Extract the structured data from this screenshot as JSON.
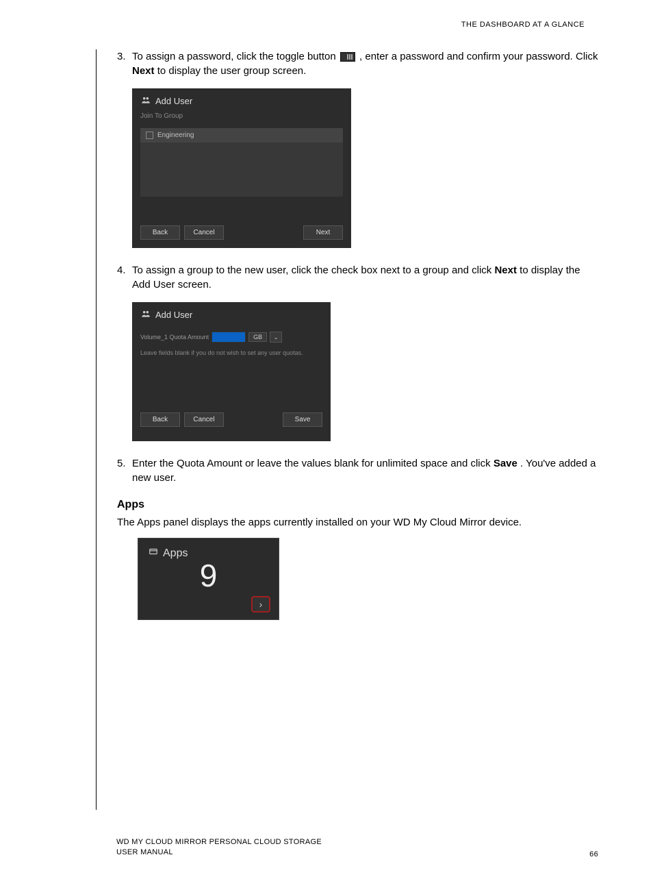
{
  "header": "THE DASHBOARD AT A GLANCE",
  "steps": {
    "s3": {
      "num": "3.",
      "pre": "To assign a password, click the toggle button ",
      "post": ", enter a password and confirm your password. Click ",
      "bold": "Next",
      "tail": " to display the user group screen."
    },
    "s4": {
      "num": "4.",
      "pre": "To assign a group to the new user, click the check box next to a group and click ",
      "bold": "Next",
      "tail": " to display the Add User screen."
    },
    "s5": {
      "num": "5.",
      "pre": "Enter the Quota Amount or leave the values blank for unlimited space and click ",
      "bold": "Save",
      "tail": ". You've added a new user."
    }
  },
  "dialog1": {
    "title": "Add User",
    "subtitle": "Join To Group",
    "group": "Engineering",
    "back": "Back",
    "cancel": "Cancel",
    "next": "Next"
  },
  "dialog2": {
    "title": "Add User",
    "quota_label": "Volume_1 Quota Amount",
    "unit": "GB",
    "hint": "Leave fields blank if you do not wish to set any user quotas.",
    "back": "Back",
    "cancel": "Cancel",
    "save": "Save"
  },
  "apps_section": {
    "heading": "Apps",
    "body": "The Apps panel displays the apps currently installed on your WD My Cloud Mirror device.",
    "tile_title": "Apps",
    "count": "9"
  },
  "footer": {
    "line1": "WD MY CLOUD MIRROR PERSONAL CLOUD STORAGE",
    "line2": "USER MANUAL",
    "page": "66"
  }
}
